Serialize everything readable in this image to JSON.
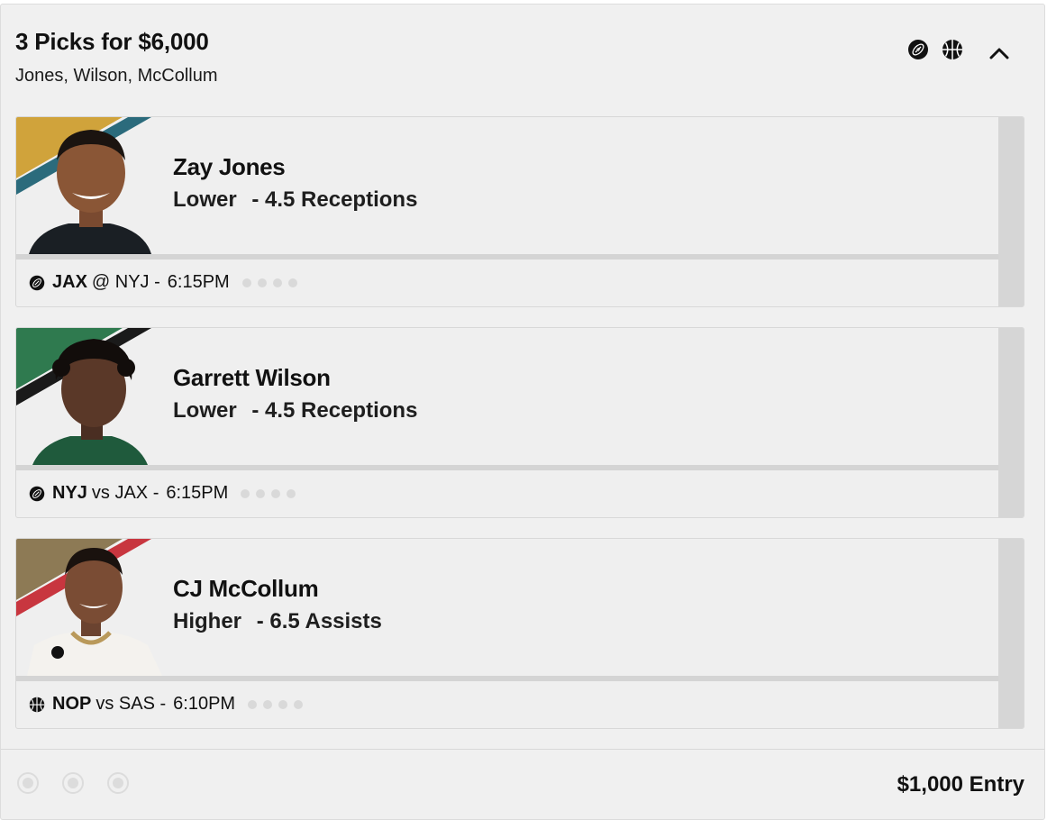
{
  "header": {
    "title": "3 Picks for $6,000",
    "subtitle": "Jones, Wilson, McCollum",
    "icons": [
      "football-icon",
      "basketball-icon"
    ],
    "collapse_icon": "chevron-up-icon"
  },
  "picks": [
    {
      "player": "Zay Jones",
      "direction": "Lower",
      "line": "- 4.5 Receptions",
      "sport_icon": "football-icon",
      "team": "JAX",
      "matchup": "@ NYJ -",
      "time": "6:15PM",
      "stripe_colors": [
        "#d0a33b",
        "#2b6b7c"
      ],
      "jersey_color": "#1a1f24"
    },
    {
      "player": "Garrett Wilson",
      "direction": "Lower",
      "line": "- 4.5 Receptions",
      "sport_icon": "football-icon",
      "team": "NYJ",
      "matchup": "vs JAX -",
      "time": "6:15PM",
      "stripe_colors": [
        "#2f7a4f",
        "#1a1a1a"
      ],
      "jersey_color": "#1f5a3c"
    },
    {
      "player": "CJ McCollum",
      "direction": "Higher",
      "line": "- 6.5 Assists",
      "sport_icon": "basketball-icon",
      "team": "NOP",
      "matchup": "vs SAS -",
      "time": "6:10PM",
      "stripe_colors": [
        "#8d7a55",
        "#c8363f"
      ],
      "jersey_color": "#f4f2ee"
    }
  ],
  "footer": {
    "entry": "$1,000 Entry"
  }
}
